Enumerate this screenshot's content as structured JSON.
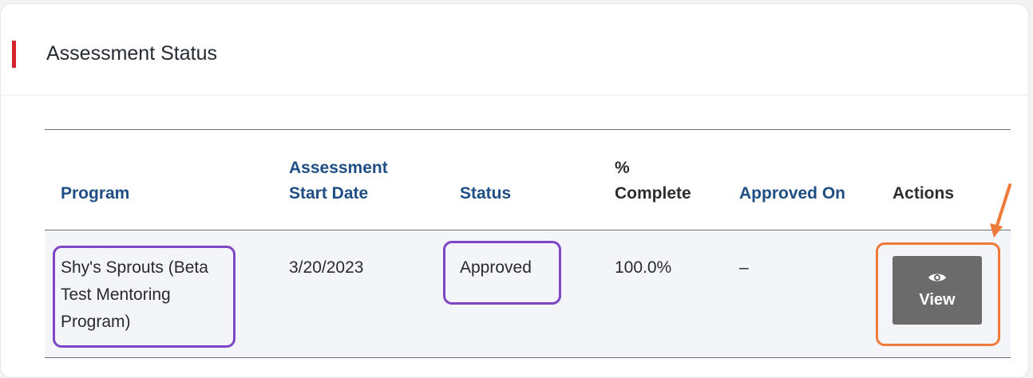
{
  "card": {
    "title": "Assessment Status",
    "accent_color": "#d2232a"
  },
  "table": {
    "columns": [
      "Program",
      "Assessment Start Date",
      "Status",
      "% Complete",
      "Approved On",
      "Actions"
    ],
    "column_lines": [
      [
        "Program"
      ],
      [
        "Assessment",
        "Start Date"
      ],
      [
        "Status"
      ],
      [
        "%",
        "Complete"
      ],
      [
        "Approved On"
      ],
      [
        "Actions"
      ]
    ],
    "rows": [
      {
        "program_lines": [
          "Shy's Sprouts (Beta",
          "Test Mentoring",
          "Program)"
        ],
        "start_date": "3/20/2023",
        "status": "Approved",
        "percent_complete": "100.0%",
        "approved_on": "–",
        "action_label": "View",
        "action_icon": "eye-icon"
      }
    ]
  },
  "annotations": {
    "highlight_purple": "#7e45c4",
    "highlight_orange": "#f07a3a"
  }
}
